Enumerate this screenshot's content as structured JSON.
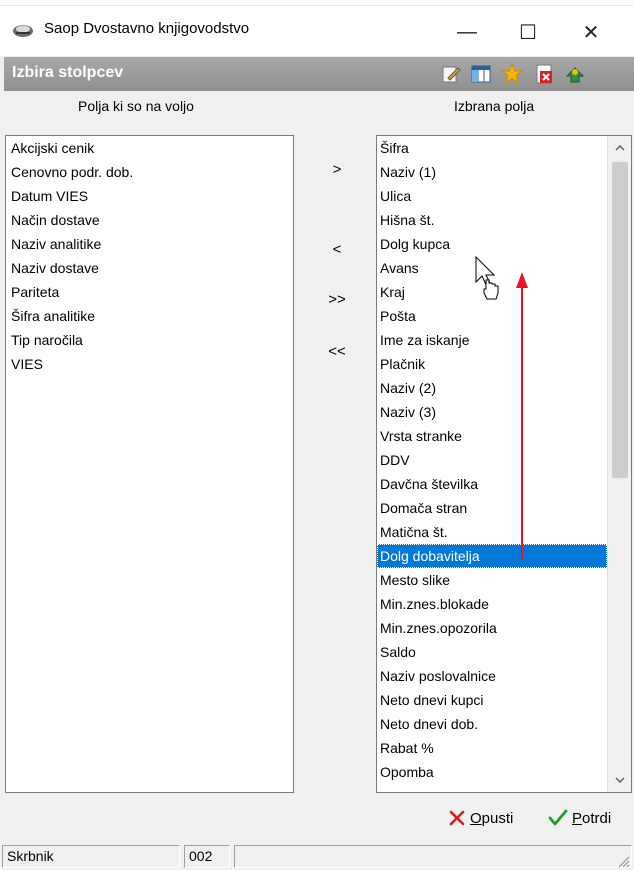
{
  "window": {
    "title": "Saop Dvostavno knjigovodstvo",
    "minimize_glyph": "—",
    "maximize_glyph": "☐",
    "close_glyph": "✕"
  },
  "header": {
    "title": "Izbira stolpcev",
    "icons": [
      "edit-icon",
      "columns-icon",
      "star-icon",
      "delete-icon",
      "exit-icon"
    ]
  },
  "available": {
    "label": "Polja ki so na voljo",
    "items": [
      "Akcijski cenik",
      "Cenovno podr. dob.",
      "Datum VIES",
      "Način dostave",
      "Naziv analitike",
      "Naziv dostave",
      "Pariteta",
      "Šifra analitike",
      "Tip naročila",
      "VIES"
    ]
  },
  "selected": {
    "label": "Izbrana polja",
    "items": [
      "Šifra",
      "Naziv (1)",
      "Ulica",
      "Hišna št.",
      "Dolg kupca",
      "Avans",
      "Kraj",
      "Pošta",
      "Ime za iskanje",
      "Plačnik",
      "Naziv (2)",
      "Naziv (3)",
      "Vrsta stranke",
      "DDV",
      "Davčna številka",
      "Domača stran",
      "Matična št.",
      "Dolg dobavitelja",
      "Mesto slike",
      "Min.znes.blokade",
      "Min.znes.opozorila",
      "Saldo",
      "Naziv poslovalnice",
      "Neto dnevi kupci",
      "Neto dnevi dob.",
      "Rabat %",
      "Opomba"
    ],
    "selected_item": "Dolg dobavitelja"
  },
  "move_buttons": {
    "add": ">",
    "remove": "<",
    "add_all": ">>",
    "remove_all": "<<"
  },
  "actions": {
    "cancel": "Opusti",
    "confirm": "Potrdi"
  },
  "status": {
    "user": "Skrbnik",
    "code": "002",
    "extra": ""
  },
  "colors": {
    "selection": "#0078d7",
    "header_bg": "#9a9a9a",
    "annotation": "#e8132a"
  }
}
